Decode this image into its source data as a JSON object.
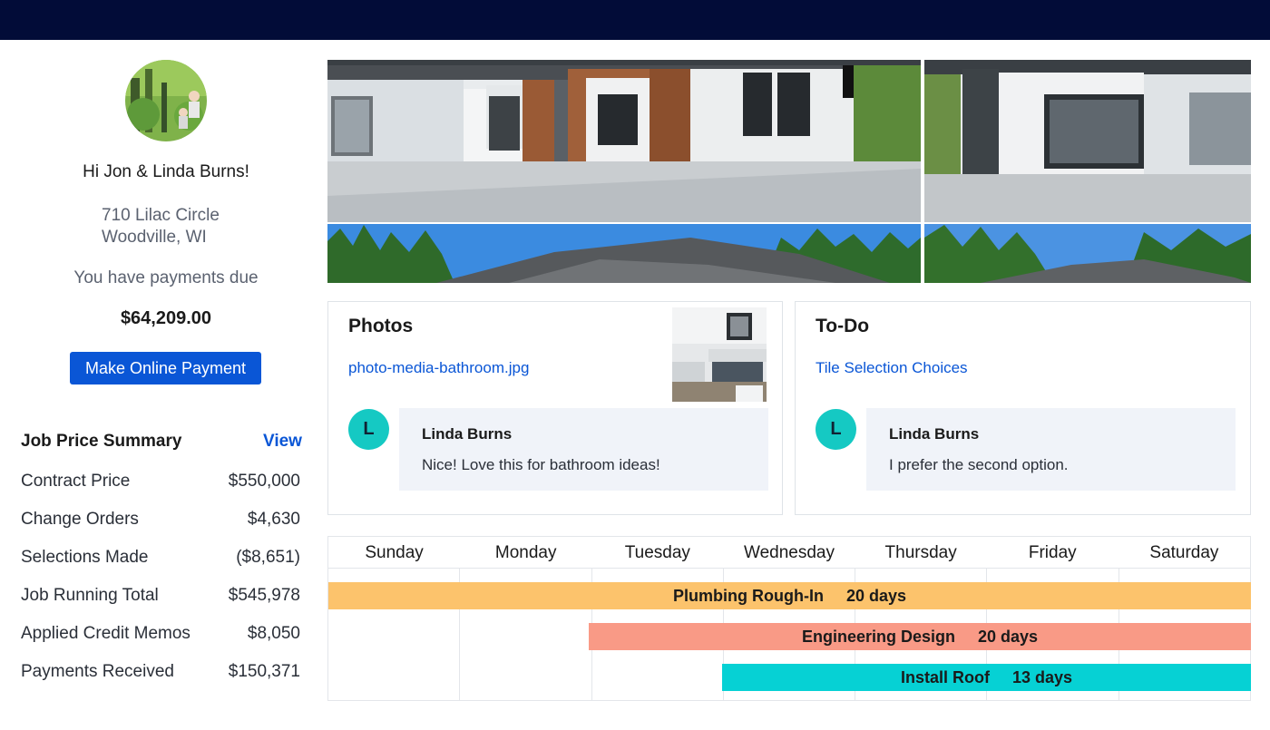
{
  "user": {
    "greeting": "Hi Jon & Linda Burns!",
    "address_line1": "710 Lilac Circle",
    "address_line2": "Woodville, WI",
    "payments_due_text": "You have payments due",
    "amount_due": "$64,209.00",
    "pay_button_label": "Make Online Payment"
  },
  "summary": {
    "title": "Job Price Summary",
    "view_label": "View",
    "rows": [
      {
        "label": "Contract Price",
        "value": "$550,000"
      },
      {
        "label": "Change Orders",
        "value": "$4,630"
      },
      {
        "label": "Selections Made",
        "value": "($8,651)"
      },
      {
        "label": "Job Running Total",
        "value": "$545,978"
      },
      {
        "label": "Applied Credit Memos",
        "value": "$8,050"
      },
      {
        "label": "Payments Received",
        "value": "$150,371"
      }
    ]
  },
  "photos_card": {
    "title": "Photos",
    "link": "photo-media-bathroom.jpg",
    "comment": {
      "initial": "L",
      "author": "Linda Burns",
      "text": "Nice! Love this for bathroom ideas!"
    }
  },
  "todo_card": {
    "title": "To-Do",
    "link": "Tile Selection Choices",
    "comment": {
      "initial": "L",
      "author": "Linda Burns",
      "text": "I prefer the second option."
    }
  },
  "calendar": {
    "days": [
      "Sunday",
      "Monday",
      "Tuesday",
      "Wednesday",
      "Thursday",
      "Friday",
      "Saturday"
    ],
    "tasks": [
      {
        "name": "Plumbing Rough-In",
        "duration": "20 days",
        "color": "#fcc36c"
      },
      {
        "name": "Engineering Design",
        "duration": "20 days",
        "color": "#f99a86"
      },
      {
        "name": "Install Roof",
        "duration": "13 days",
        "color": "#06d1d4"
      }
    ]
  },
  "colors": {
    "topbar": "#020c38",
    "accent": "#0a56d6",
    "avatar_teal": "#15c9c3"
  }
}
